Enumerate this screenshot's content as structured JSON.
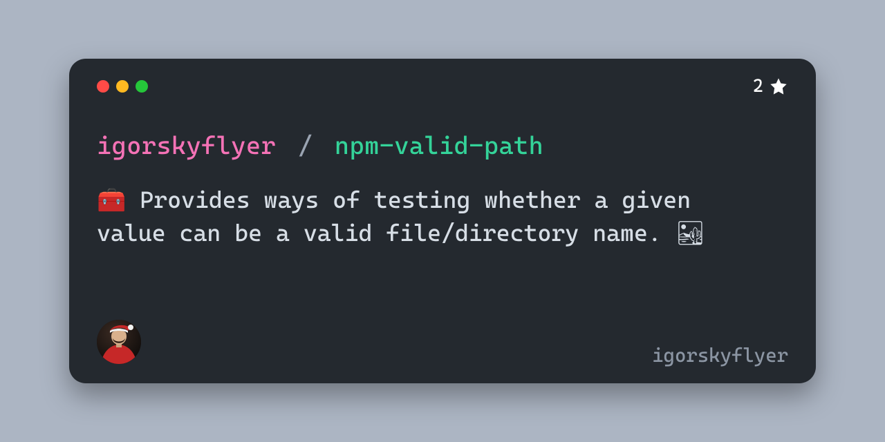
{
  "header": {
    "star_count": "2"
  },
  "repo": {
    "owner": "igorskyflyer",
    "separator": "/",
    "name": "npm-valid-path"
  },
  "description": "🧰 Provides ways of testing whether a given value can be a valid file/directory name. 🏜",
  "footer": {
    "username": "igorskyflyer"
  },
  "colors": {
    "owner": "#f472b6",
    "repo": "#34d399",
    "card_bg": "#24292f",
    "page_bg": "#acb5c3"
  }
}
